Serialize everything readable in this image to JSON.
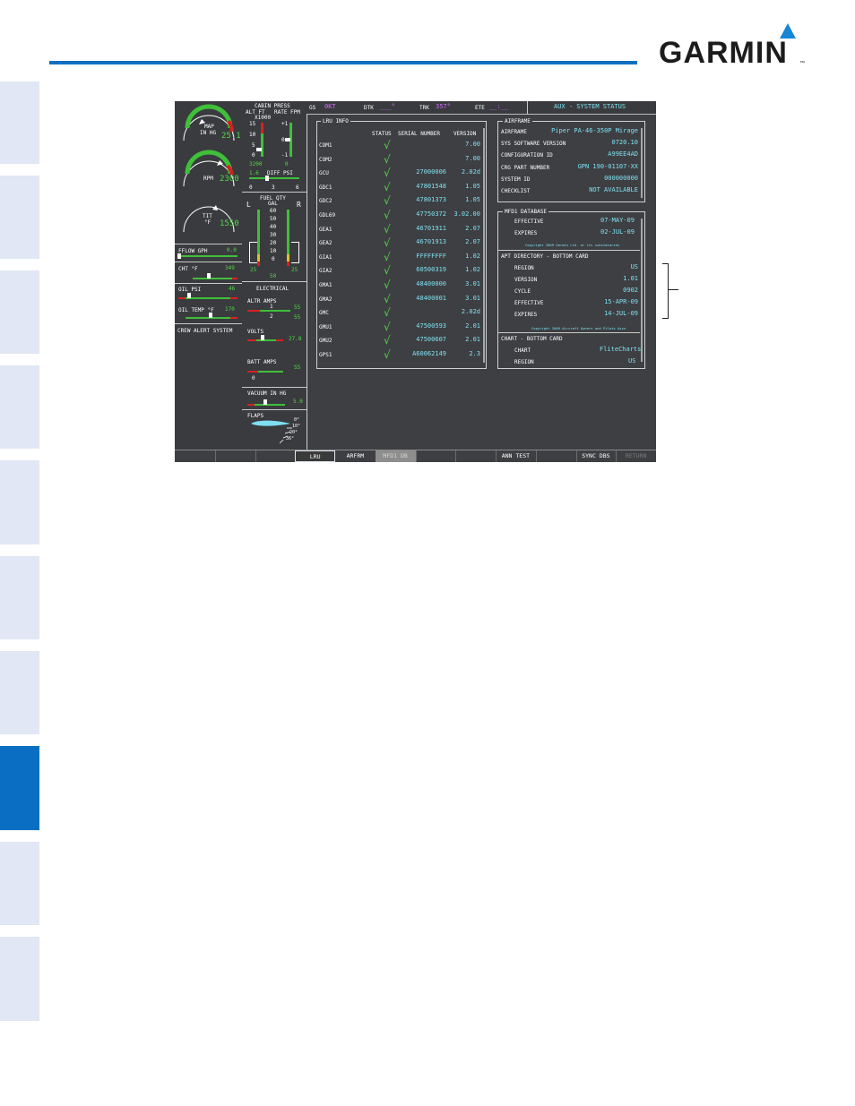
{
  "brand": {
    "name": "GARMIN",
    "trademark": "™",
    "accent": "#0a6fc2"
  },
  "nav_bar": {
    "gs_label": "GS",
    "gs_value": "0KT",
    "dtk_label": "DTK",
    "dtk_value": "___°",
    "trk_label": "TRK",
    "trk_value": "357°",
    "ete_label": "ETE",
    "ete_value": "__:__",
    "page_title": "AUX - SYSTEM STATUS"
  },
  "eis_left": {
    "map_label": "MAP",
    "map_unit": "IN HG",
    "map_value": "25.1",
    "rpm_label": "RPM",
    "rpm_value": "2300",
    "tit_label": "TIT",
    "tit_unit": "°F",
    "tit_value": "1550",
    "fflow_label": "FFLOW GPH",
    "fflow_value": "0.0",
    "cht_label": "CHT °F",
    "cht_value": "349",
    "oil_psi_label": "OIL PSI",
    "oil_psi_value": "46",
    "oil_temp_label": "OIL TEMP °F",
    "oil_temp_value": "170",
    "crew_alert": "CREW ALERT SYSTEM"
  },
  "eis_right": {
    "cabin_press": "CABIN PRESS",
    "alt_ft": "ALT FT",
    "rate_fpm": "RATE FPM",
    "x1000": "X1000",
    "alt_ticks": [
      "15",
      "10",
      "5",
      "0"
    ],
    "rate_ticks": [
      "+1",
      "0",
      "-1"
    ],
    "cabin_alt": "3200",
    "cabin_rate": "0",
    "diff_psi_value": "1.6",
    "diff_psi_label": "DIFF PSI",
    "diff_ticks": [
      "0",
      "3",
      "6"
    ],
    "fuel_qty": "FUEL QTY",
    "gal": "GAL",
    "fuel_l": "L",
    "fuel_r": "R",
    "fuel_ticks": [
      "60",
      "50",
      "40",
      "30",
      "20",
      "10",
      "0"
    ],
    "fuel_left_value": "25",
    "fuel_right_value": "25",
    "fuel_total": "50",
    "electrical": "ELECTRICAL",
    "altr_amps": "ALTR AMPS",
    "altr_1": "55",
    "altr_2": "55",
    "altr_idx1": "1",
    "altr_idx2": "2",
    "volts": "VOLTS",
    "volts_value": "27.8",
    "batt_amps": "BATT AMPS",
    "batt_value": "55",
    "batt_zero": "0",
    "vacuum": "VACUUM IN HG",
    "vacuum_value": "5.0",
    "flaps": "FLAPS",
    "flap_ticks": [
      "0°",
      "10°",
      "20°",
      "36°"
    ]
  },
  "lru_info": {
    "title": "LRU INFO",
    "headers": [
      "STATUS",
      "SERIAL NUMBER",
      "VERSION"
    ],
    "rows": [
      {
        "name": "COM1",
        "serial": "",
        "version": "7.00"
      },
      {
        "name": "COM2",
        "serial": "",
        "version": "7.00"
      },
      {
        "name": "GCU",
        "serial": "27000006",
        "version": "2.02d"
      },
      {
        "name": "GDC1",
        "serial": "47801548",
        "version": "1.05"
      },
      {
        "name": "GDC2",
        "serial": "47801373",
        "version": "1.05"
      },
      {
        "name": "GDL69",
        "serial": "47750372",
        "version": "3.02.00"
      },
      {
        "name": "GEA1",
        "serial": "46701911",
        "version": "2.07"
      },
      {
        "name": "GEA2",
        "serial": "46701913",
        "version": "2.07"
      },
      {
        "name": "GIA1",
        "serial": "FFFFFFFF",
        "version": "1.02"
      },
      {
        "name": "GIA2",
        "serial": "60500319",
        "version": "1.02"
      },
      {
        "name": "GMA1",
        "serial": "48400000",
        "version": "3.01"
      },
      {
        "name": "GMA2",
        "serial": "48400001",
        "version": "3.01"
      },
      {
        "name": "GMC",
        "serial": "",
        "version": "2.02d"
      },
      {
        "name": "GMU1",
        "serial": "47500593",
        "version": "2.01"
      },
      {
        "name": "GMU2",
        "serial": "47500607",
        "version": "2.01"
      },
      {
        "name": "GPS1",
        "serial": "A60062149",
        "version": "2.3"
      }
    ]
  },
  "airframe": {
    "title": "AIRFRAME",
    "rows": [
      {
        "label": "AIRFRAME",
        "value": "Piper PA-46-350P Mirage"
      },
      {
        "label": "SYS SOFTWARE VERSION",
        "value": "0720.10"
      },
      {
        "label": "CONFIGURATION ID",
        "value": "A99EE4AD"
      },
      {
        "label": "CRG PART NUMBER",
        "value": "GPN 190-01107-XX"
      },
      {
        "label": "SYSTEM ID",
        "value": "000000000"
      },
      {
        "label": "CHECKLIST",
        "value": "NOT AVAILABLE"
      }
    ]
  },
  "mfd1_database": {
    "title": "MFD1 DATABASE",
    "effective_label": "EFFECTIVE",
    "effective_value": "07-MAY-09",
    "expires_label": "EXPIRES",
    "expires_value": "02-JUL-09",
    "copyright1": "Copyright 2009 Garmin Ltd. or its subsidiaries",
    "apt_header": "APT DIRECTORY - BOTTOM CARD",
    "apt_rows": [
      {
        "label": "REGION",
        "value": "US"
      },
      {
        "label": "VERSION",
        "value": "1.01"
      },
      {
        "label": "CYCLE",
        "value": "0902"
      },
      {
        "label": "EFFECTIVE",
        "value": "15-APR-09"
      },
      {
        "label": "EXPIRES",
        "value": "14-JUL-09"
      }
    ],
    "copyright2": "Copyright 2009 Aircraft Owners and Pilots Assn",
    "chart_header": "CHART - BOTTOM CARD",
    "chart_label": "CHART",
    "chart_value": "FliteCharts",
    "region_label": "REGION",
    "region_value": "US"
  },
  "softkeys": [
    "",
    "",
    "",
    "LRU",
    "ARFRM",
    "MFD1 DB",
    "",
    "",
    "ANN TEST",
    "",
    "SYNC DBS",
    "RETURN"
  ]
}
